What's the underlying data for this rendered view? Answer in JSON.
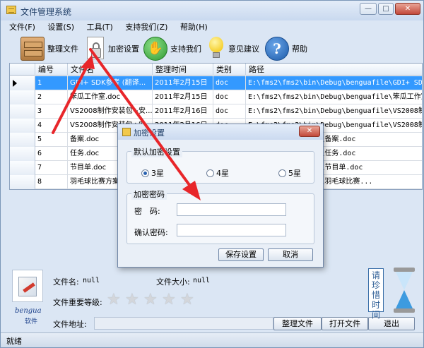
{
  "window": {
    "title": "文件管理系统",
    "min_glyph": "—",
    "max_glyph": "□",
    "close_glyph": "✕"
  },
  "menu": [
    "文件(F)",
    "设置(S)",
    "工具(T)",
    "支持我们(Z)",
    "帮助(H)"
  ],
  "toolbar": [
    {
      "icon": "cabinet-icon",
      "label": "整理文件"
    },
    {
      "icon": "lock-icon",
      "label": "加密设置"
    },
    {
      "icon": "hand-icon",
      "label": "支持我们"
    },
    {
      "icon": "bulb-icon",
      "label": "意见建议"
    },
    {
      "icon": "help-icon",
      "label": "帮助",
      "glyph": "?"
    }
  ],
  "table": {
    "columns": [
      "编号",
      "文件名",
      "整理时间",
      "类别",
      "路径"
    ],
    "rows": [
      {
        "id": "1",
        "name": "GDI+ SDK参考 (翻译...",
        "time": "2011年2月15日",
        "type": "doc",
        "path": "E:\\fms2\\fms2\\bin\\Debug\\benguafile\\GDI+ SDK参..."
      },
      {
        "id": "2",
        "name": "笨瓜工作室.doc",
        "time": "2011年2月15日",
        "type": "doc",
        "path": "E:\\fms2\\fms2\\bin\\Debug\\benguafile\\笨瓜工作室..."
      },
      {
        "id": "3",
        "name": "VS2008制作安装包+安...",
        "time": "2011年2月16日",
        "type": "doc",
        "path": "E:\\fms2\\fms2\\bin\\Debug\\benguafile\\VS2008制作..."
      },
      {
        "id": "4",
        "name": "VS2008制作安装包+安...",
        "time": "2011年2月16日",
        "type": "doc",
        "path": "E:\\fms2\\fms2\\bin\\Debug\\benguafile\\VS2008制作..."
      },
      {
        "id": "5",
        "name": "备案.doc",
        "time": "",
        "type": "",
        "path": "\\Debug\\benguafile\\备案.doc"
      },
      {
        "id": "6",
        "name": "任务.doc",
        "time": "",
        "type": "",
        "path": "\\Debug\\benguafile\\任务.doc"
      },
      {
        "id": "7",
        "name": "节目单.doc",
        "time": "",
        "type": "",
        "path": "\\Debug\\benguafile\\节目单.doc"
      },
      {
        "id": "8",
        "name": "羽毛球比赛方案",
        "time": "",
        "type": "",
        "path": "\\Debug\\benguafile\\羽毛球比赛..."
      }
    ],
    "selected_row": 0
  },
  "bottom": {
    "logo_text": "bengua",
    "logo_sub": "软件",
    "filename_label": "文件名:",
    "filename_value": "null",
    "filesize_label": "文件大小:",
    "filesize_value": "null",
    "importance_label": "文件重要等级:",
    "stars_total": 5,
    "stars_filled": 0,
    "star_glyph": "★",
    "path_label": "文件地址:",
    "path_value": "",
    "btn_organize": "整理文件",
    "btn_open": "打开文件",
    "btn_exit": "退出",
    "time_notice": "请珍惜时间"
  },
  "status": {
    "text": "就绪"
  },
  "dialog": {
    "title": "加密设置",
    "close_glyph": "✕",
    "group1_title": "默认加密设置",
    "options": [
      "3星",
      "4星",
      "5星"
    ],
    "selected_option": 0,
    "group2_title": "加密密码",
    "password_label": "密　码:",
    "password_value": "",
    "confirm_label": "确认密码:",
    "confirm_value": "",
    "save_label": "保存设置",
    "cancel_label": "取消"
  },
  "colors": {
    "selection": "#3399ff",
    "annotation_arrow": "#e8262a"
  }
}
